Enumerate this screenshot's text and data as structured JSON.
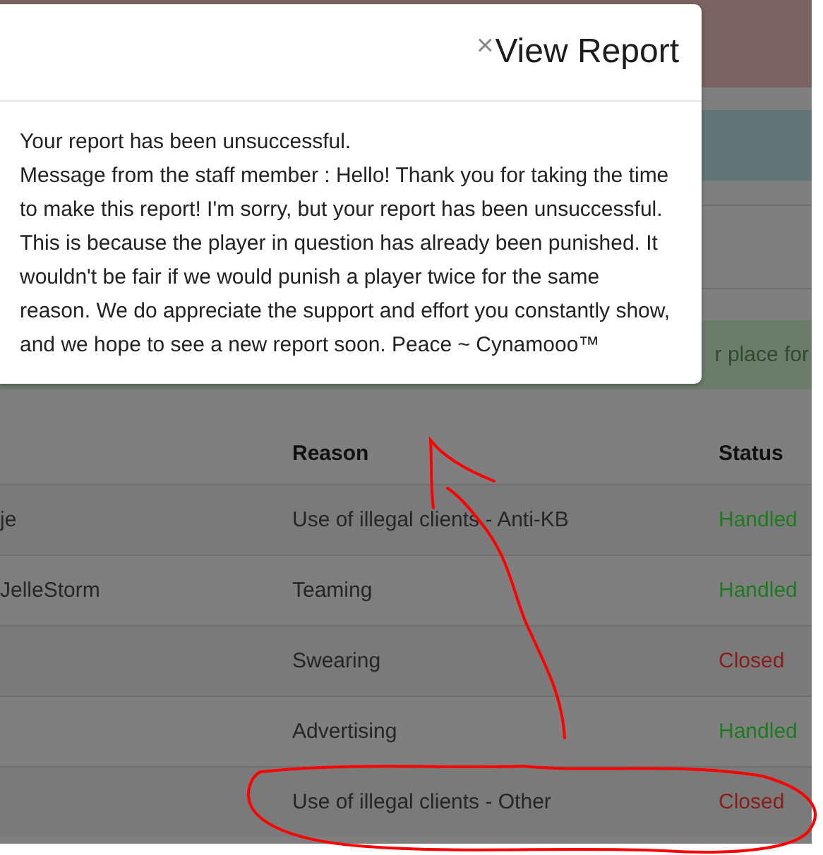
{
  "background_alerts": [
    {
      "kind": "danger"
    },
    {
      "kind": "info"
    },
    {
      "kind": "card"
    },
    {
      "kind": "success",
      "text": "r place for"
    }
  ],
  "modal": {
    "close": "×",
    "title": "View Report",
    "body": [
      "Your report has been unsuccessful.",
      "Message from the staff member : Hello! Thank you for taking the time to make this report! I'm sorry, but your report has been unsuccessful. This is because the player in question has already been punished. It wouldn't be fair if we would punish a player twice for the same reason. We do appreciate the support and effort you constantly show, and we hope to see a new report soon. Peace ~ Cynamooo™"
    ]
  },
  "table": {
    "columns": [
      {
        "label": "Reason"
      },
      {
        "label": "Status"
      }
    ],
    "rows": [
      {
        "player": "je",
        "reason": "Use of illegal clients - Anti-KB",
        "status": "Handled",
        "color": "#1f7a1f"
      },
      {
        "player": "JelleStorm",
        "reason": "Teaming",
        "status": "Handled",
        "color": "#1f7a1f"
      },
      {
        "player": "",
        "reason": "Swearing",
        "status": "Closed",
        "color": "#8a1c1c"
      },
      {
        "player": "",
        "reason": "Advertising",
        "status": "Handled",
        "color": "#1f7a1f"
      },
      {
        "player": "",
        "reason": "Use of illegal clients - Other",
        "status": "Closed",
        "color": "#8a1c1c"
      }
    ]
  }
}
